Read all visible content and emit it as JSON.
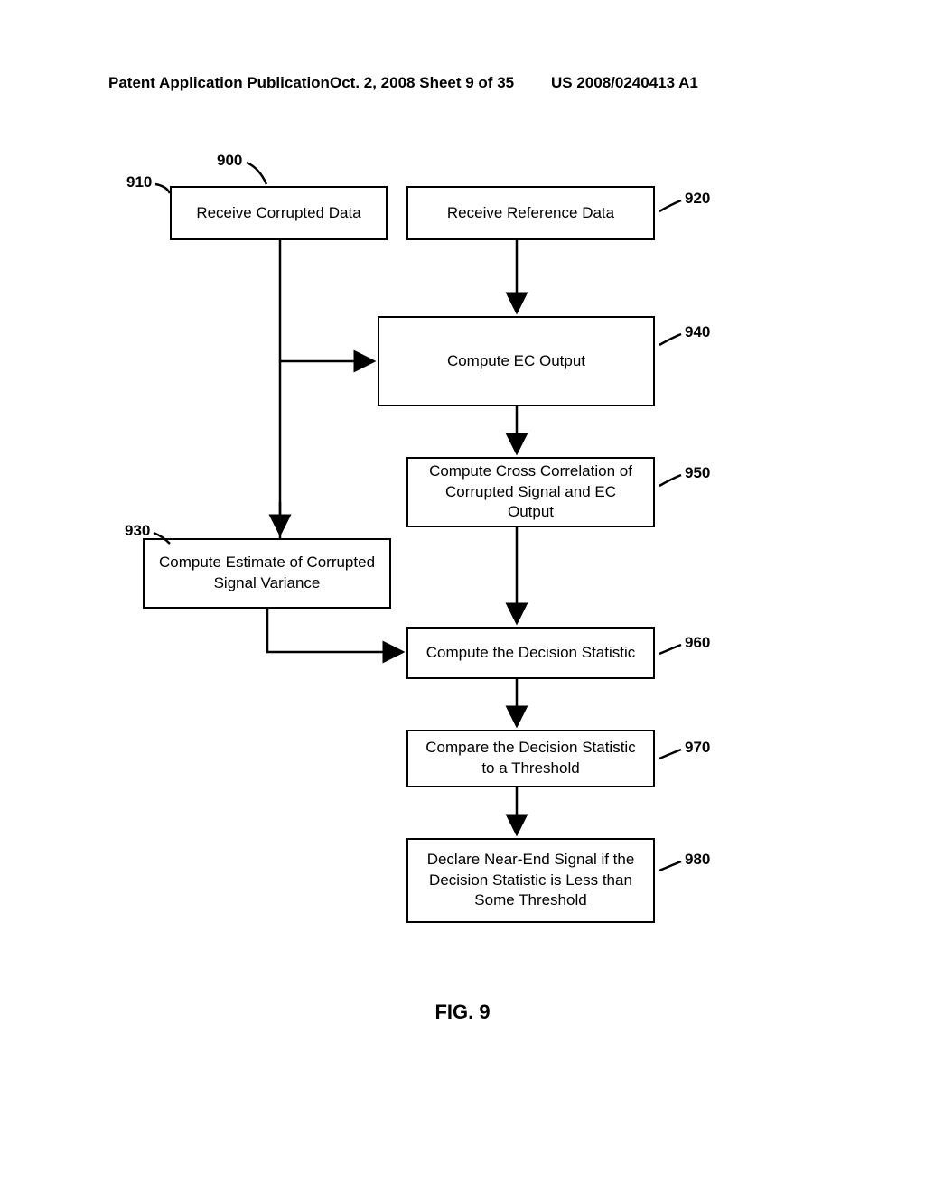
{
  "header": {
    "left": "Patent Application Publication",
    "mid": "Oct. 2, 2008  Sheet 9 of 35",
    "right": "US 2008/0240413 A1"
  },
  "labels": {
    "r900": "900",
    "r910": "910",
    "r920": "920",
    "r930": "930",
    "r940": "940",
    "r950": "950",
    "r960": "960",
    "r970": "970",
    "r980": "980"
  },
  "boxes": {
    "b910": "Receive Corrupted Data",
    "b920": "Receive Reference Data",
    "b930": "Compute Estimate of Corrupted Signal Variance",
    "b940": "Compute EC Output",
    "b950": "Compute Cross Correlation of Corrupted Signal and EC Output",
    "b960": "Compute the Decision Statistic",
    "b970": "Compare the Decision Statistic to a Threshold",
    "b980": "Declare Near-End Signal if the Decision Statistic is Less than Some Threshold"
  },
  "figure": "FIG. 9"
}
